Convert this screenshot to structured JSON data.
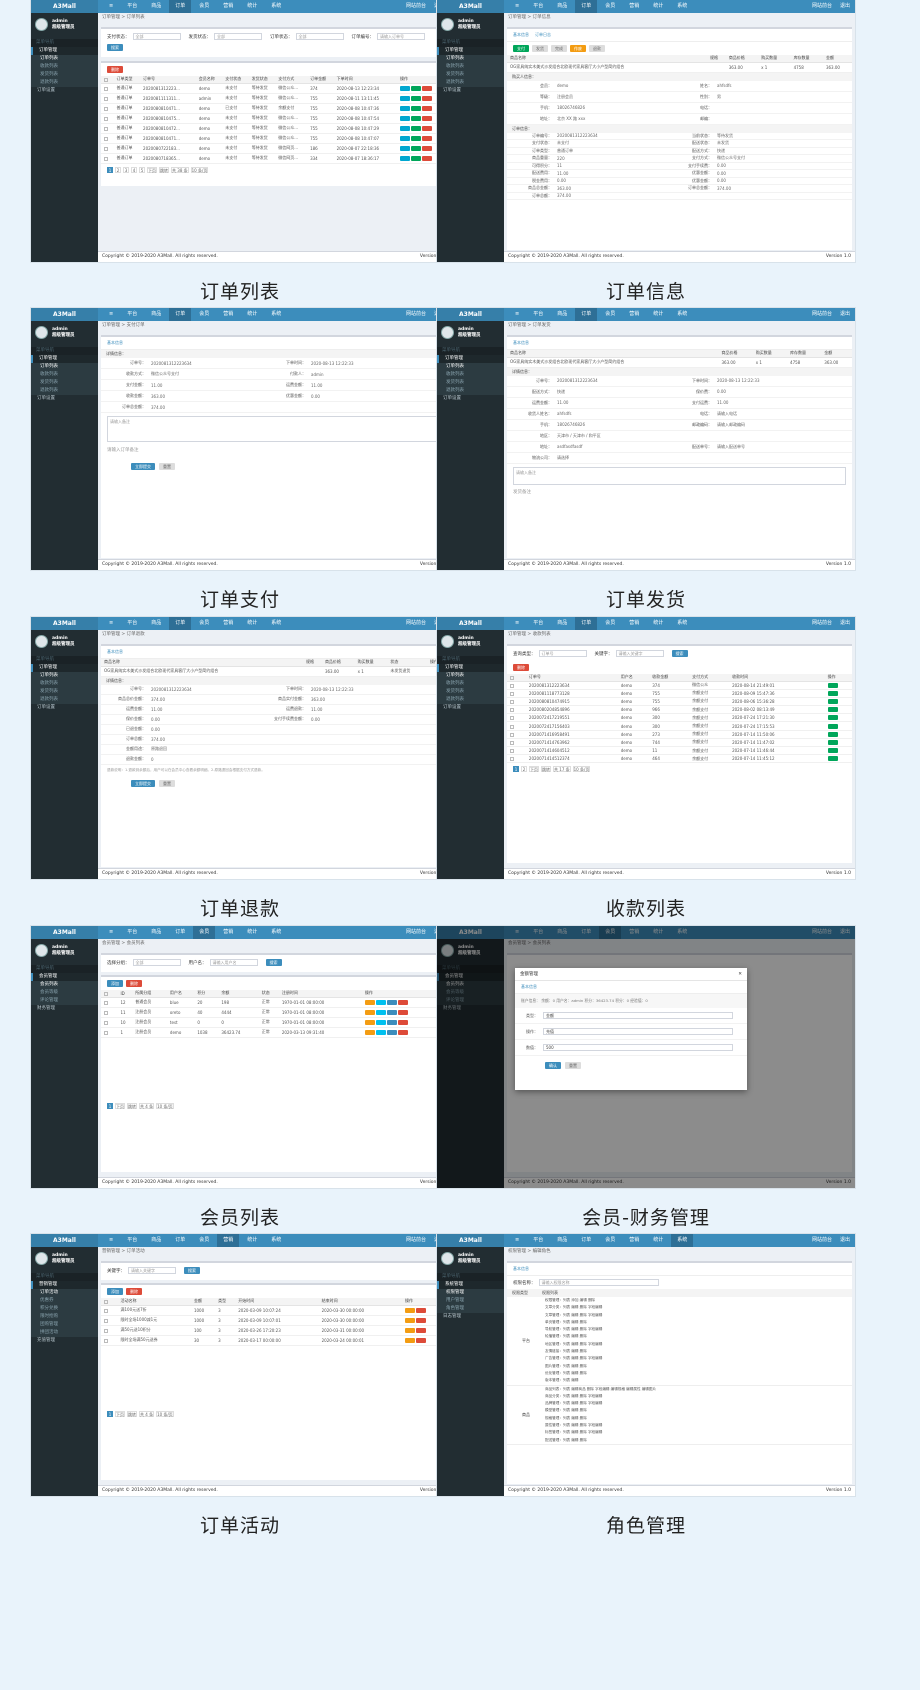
{
  "chrome": {
    "brand": "A3Mall",
    "top_nav": [
      "≡",
      "平台",
      "商品",
      "订单",
      "会员",
      "营销",
      "统计",
      "系统"
    ],
    "top_right": [
      "网站前台",
      "退出"
    ],
    "user_name": "admin",
    "user_role": "超级管理员",
    "search_label": "菜单导航",
    "footer_left": "Copyright © 2019-2020 A3Mall. All rights reserved.",
    "footer_right": "Version 1.0"
  },
  "screens": [
    {
      "caption": "订单列表",
      "crumb": "订单管理 > 订单列表",
      "menu": [
        "订单管理",
        "订单列表",
        "收款列表",
        "发货列表",
        "退款列表",
        "订单设置"
      ],
      "filters": [
        "支付状态：",
        "发货状态：",
        "订单状态：",
        "订单编号："
      ],
      "filter_values": [
        "全部",
        "全部",
        "全部",
        "请输入订单号"
      ],
      "search_btn": "搜索",
      "delete_btn": "删除",
      "columns": [
        "订单类型",
        "订单号",
        "会员名称",
        "支付状态",
        "发货状态",
        "支付方式",
        "订单金额",
        "下单时间",
        "操作"
      ],
      "rows": [
        [
          "普通订单",
          "2020081312223...",
          "demo",
          "未支付",
          "等待发货",
          "微信公众...",
          "374",
          "2020-08-13 12:23:34"
        ],
        [
          "普通订单",
          "2020081111311...",
          "admin",
          "未支付",
          "等待发货",
          "微信公众...",
          "755",
          "2020-08-11 13:11:45"
        ],
        [
          "普通订单",
          "2020080810471...",
          "demo",
          "已支付",
          "等待发货",
          "余额支付",
          "755",
          "2020-08-08 10:47:36"
        ],
        [
          "普通订单",
          "2020080810475...",
          "demo",
          "未支付",
          "等待发货",
          "微信公众...",
          "755",
          "2020-08-08 10:47:54"
        ],
        [
          "普通订单",
          "2020080810472...",
          "demo",
          "未支付",
          "等待发货",
          "微信公众...",
          "755",
          "2020-08-08 10:47:29"
        ],
        [
          "普通订单",
          "2020080810471...",
          "demo",
          "未支付",
          "等待发货",
          "微信公众...",
          "755",
          "2020-08-08 10:47:07"
        ],
        [
          "普通订单",
          "2020080722183...",
          "demo",
          "未支付",
          "等待发货",
          "微信网页...",
          "186",
          "2020-08-07 22:18:36"
        ],
        [
          "普通订单",
          "2020080718365...",
          "demo",
          "未支付",
          "等待发货",
          "微信网页...",
          "334",
          "2020-08-07 18:36:17"
        ]
      ],
      "pager": [
        "1",
        "2",
        "3",
        "4",
        "5",
        "下页",
        "跳转",
        "共 38 条",
        "10 条/页"
      ]
    },
    {
      "caption": "订单信息",
      "crumb": "订单管理 > 订单信息",
      "menu": [
        "订单管理",
        "订单列表",
        "收款列表",
        "发货列表",
        "退款列表",
        "订单设置"
      ],
      "tabs": [
        "基本信息",
        "订单日志"
      ],
      "action_btns": [
        "支付",
        "发货",
        "完成",
        "作废",
        "退款"
      ],
      "goods_columns": [
        "商品名称",
        "规格",
        "商品价格",
        "购买数量",
        "库存数量",
        "金额"
      ],
      "goods_row": [
        "OG家具纯实木美式沙发组合北欧现代家具客厅大小户型简约组合",
        "",
        "363.00",
        "x 1",
        "4758",
        "363.00"
      ],
      "buyer_title": "购买人信息：",
      "buyer": [
        [
          "会员：",
          "demo",
          "姓名：",
          "ahfsdfs"
        ],
        [
          "等级：",
          "注册会员",
          "性别：",
          "男"
        ],
        [
          "手机：",
          "18026746826",
          "电话：",
          ""
        ],
        [
          "地址：",
          "北京 XX 路 xxx",
          "邮编：",
          ""
        ]
      ],
      "order_title": "订单信息：",
      "order": [
        [
          "订单编号：",
          "2020081312223634",
          "当前状态：",
          "等待发货"
        ],
        [
          "支付状态：",
          "未支付",
          "配送状态：",
          "未发货"
        ],
        [
          "订单类型：",
          "普通订单",
          "配送方式：",
          "快递"
        ],
        [
          "商品重量：",
          "220",
          "支付方式：",
          "微信公众号支付"
        ],
        [
          "可得积分：",
          "11",
          "支付手续费：",
          "0.00"
        ],
        [
          "配送费用：",
          "11.00",
          "优惠金额：",
          "0.00"
        ],
        [
          "税金费用：",
          "0.00",
          "优惠金额：",
          "0.00"
        ],
        [
          "商品总金额：",
          "363.00",
          "订单总金额：",
          "374.00"
        ],
        [
          "订单总额：",
          "374.00",
          "",
          ""
        ]
      ]
    },
    {
      "caption": "订单支付",
      "crumb": "订单管理 > 支付订单",
      "menu": [
        "订单管理",
        "订单列表",
        "收款列表",
        "发货列表",
        "退款列表",
        "订单设置"
      ],
      "tab": "基本信息",
      "section": "详情信息：",
      "rows": [
        [
          "订单号：",
          "2020081312223634",
          "下单时间：",
          "2020-08-13 12:22:33"
        ],
        [
          "收款方式：",
          "微信公众号支付",
          "付款人：",
          "admin"
        ],
        [
          "支付金额：",
          "11.00",
          "运费金额：",
          "11.00"
        ],
        [
          "收款金额：",
          "363.00",
          "优惠金额：",
          "0.00"
        ],
        [
          "订单总金额：",
          "374.00",
          "",
          ""
        ]
      ],
      "note_placeholder": "请输入备注",
      "note_hint": "请输入订单备注",
      "submit": "立即提交",
      "reset": "重置"
    },
    {
      "caption": "订单发货",
      "crumb": "订单管理 > 订单发货",
      "menu": [
        "订单管理",
        "订单列表",
        "收款列表",
        "发货列表",
        "退款列表",
        "订单设置"
      ],
      "tab": "基本信息",
      "goods_columns": [
        "商品名称",
        "商品价格",
        "购买数量",
        "库存数量",
        "金额"
      ],
      "goods_row": [
        "OG家具纯实木美式沙发组合北欧现代家具客厅大小户型简约组合",
        "363.00",
        "x 1",
        "4758",
        "363.00"
      ],
      "section": "详情信息：",
      "rows": [
        [
          "订单号：",
          "2020081312223634",
          "下单时间：",
          "2020-08-13 12:22:33"
        ],
        [
          "配送方式：",
          "快递",
          "保价费：",
          "0.00"
        ],
        [
          "运费金额：",
          "11.00",
          "支付运费：",
          "11.00"
        ],
        [
          "收货人姓名：",
          "ahfsdfs",
          "电话：",
          "请输入电话"
        ],
        [
          "手机：",
          "18026746826",
          "邮政编码：",
          "请输入邮政编码"
        ],
        [
          "地区：",
          "天津市 / 天津市 / 和平区",
          "",
          ""
        ],
        [
          "地址：",
          "asdfasdfasdf",
          "配送单号：",
          "请输入配送单号"
        ],
        [
          "物流公司：",
          "请选择",
          "",
          ""
        ]
      ],
      "note_placeholder": "请输入备注",
      "note_hint": "发货备注"
    },
    {
      "caption": "订单退款",
      "crumb": "订单管理 > 订单退款",
      "menu": [
        "订单管理",
        "订单列表",
        "收款列表",
        "发货列表",
        "退款列表",
        "订单设置"
      ],
      "tab": "基本信息",
      "goods_columns": [
        "商品名称",
        "规格",
        "商品价格",
        "购买数量",
        "状态",
        "操作"
      ],
      "goods_row": [
        "OG家具纯实木美式沙发组合北欧现代家具客厅大小户型简约组合",
        "",
        "363.00",
        "x 1",
        "未发货退货",
        ""
      ],
      "section": "详情信息：",
      "rows": [
        [
          "订单号：",
          "2020081312223634",
          "下单时间：",
          "2020-08-13 12:22:33"
        ],
        [
          "商品总价金额：",
          "374.00",
          "商品实付金额：",
          "363.00"
        ],
        [
          "运费金额：",
          "11.00",
          "运费退款：",
          "11.00"
        ],
        [
          "保价金额：",
          "0.00",
          "支付手续费金额：",
          "0.00"
        ],
        [
          "已退金额：",
          "0.00",
          "",
          ""
        ],
        [
          "订单总额：",
          "374.00",
          "",
          ""
        ],
        [
          "金额用途：",
          "原路退回",
          "",
          ""
        ],
        [
          "退款金额：",
          "0",
          "",
          ""
        ]
      ],
      "hint": "退款说明：1.退款到余额后，用户可以在会员中心查看余额明细。2.原路退回会根据支付方式退款。",
      "submit": "立即提交",
      "reset": "重置"
    },
    {
      "caption": "收款列表",
      "crumb": "订单管理 > 收款列表",
      "menu": [
        "订单管理",
        "订单列表",
        "收款列表",
        "发货列表",
        "退款列表",
        "订单设置"
      ],
      "filters": [
        "查询类型：",
        "关键字："
      ],
      "filter_values": [
        "订单号",
        "请输入关键字"
      ],
      "search_btn": "搜索",
      "delete_btn": "删除",
      "columns": [
        "订单号",
        "用户名",
        "收款金额",
        "支付方式",
        "收款时间",
        "操作"
      ],
      "rows": [
        [
          "2020081312223634",
          "demo",
          "374",
          "微信公众",
          "2020-08-14 21:49:01"
        ],
        [
          "2020081118773128",
          "demo",
          "755",
          "余额支付",
          "2020-08-09 15:47:36"
        ],
        [
          "2020080810474915",
          "demo",
          "755",
          "余额支付",
          "2020-08-06 15:36:28"
        ],
        [
          "2020080204854896",
          "demo",
          "966",
          "余额支付",
          "2020-08-02 08:13:49"
        ],
        [
          "2020072417219551",
          "demo",
          "300",
          "余额支付",
          "2020-07-24 17:21:30"
        ],
        [
          "2020072417156403",
          "demo",
          "300",
          "余额支付",
          "2020-07-24 17:15:53"
        ],
        [
          "2020071416958491",
          "demo",
          "273",
          "余额支付",
          "2020-07-14 11:50:06"
        ],
        [
          "2020071414763962",
          "demo",
          "744",
          "余额支付",
          "2020-07-14 11:47:02"
        ],
        [
          "2020071414604512",
          "demo",
          "11",
          "余额支付",
          "2020-07-14 11:46:44"
        ],
        [
          "2020071414512374",
          "demo",
          "464",
          "余额支付",
          "2020-07-14 11:45:12"
        ]
      ],
      "pager": [
        "1",
        "2",
        "下页",
        "跳转",
        "共 17 条",
        "10 条/页"
      ]
    },
    {
      "caption": "会员列表",
      "crumb": "会员管理 > 会员列表",
      "menu": [
        "会员管理",
        "会员列表",
        "会员等级",
        "评论管理",
        "财务管理"
      ],
      "filters": [
        "选择分组：",
        "用户名："
      ],
      "filter_values": [
        "全部",
        "请输入用户名"
      ],
      "search_btn": "搜索",
      "add_btn": "添加",
      "delete_btn": "删除",
      "columns": [
        "ID",
        "所属分组",
        "用户名",
        "积分",
        "余额",
        "状态",
        "注册时间",
        "操作"
      ],
      "rows": [
        [
          "12",
          "普通会员",
          "blue",
          "20",
          "198",
          "正常",
          "1970-01-01 08:00:00"
        ],
        [
          "11",
          "注册会员",
          "oreto",
          "40",
          "4444",
          "正常",
          "1970-01-01 08:00:00"
        ],
        [
          "10",
          "注册会员",
          "test",
          "0",
          "0",
          "正常",
          "1970-01-01 08:00:00"
        ],
        [
          "1",
          "注册会员",
          "demo",
          "1038",
          "36423.74",
          "正常",
          "2020-03-13 09:31:40"
        ]
      ],
      "pager": [
        "1",
        "下页",
        "跳转",
        "共 4 条",
        "10 条/页"
      ]
    },
    {
      "caption": "会员-财务管理",
      "crumb": "会员管理 > 会员列表",
      "menu": [
        "会员管理",
        "会员列表",
        "会员等级",
        "评论管理",
        "财务管理"
      ],
      "modal_title": "金额管理",
      "modal_tab": "基本信息",
      "account_line": "账户信息：  余额：0  用户名：admin  积分：36423.74  积分：0  经验值：0",
      "fields": [
        [
          "类型：",
          "金额"
        ],
        [
          "操作：",
          "充值"
        ],
        [
          "数值：",
          "500"
        ]
      ],
      "confirm": "确认",
      "reset": "重置"
    },
    {
      "caption": "订单活动",
      "crumb": "营销管理 > 订单活动",
      "menu": [
        "营销管理",
        "订单活动",
        "优惠券",
        "积分兑换",
        "限时抢购",
        "团购管理",
        "拼团活动",
        "充值管理"
      ],
      "filters": [
        "关键字："
      ],
      "filter_values": [
        "请输入关键字"
      ],
      "search_btn": "搜索",
      "add_btn": "添加",
      "delete_btn": "删除",
      "columns": [
        "活动名称",
        "金额",
        "类型",
        "开始时间",
        "结束时间",
        "操作"
      ],
      "rows": [
        [
          "满100元送7折",
          "1000",
          "3",
          "2020-03-09 10:07:24",
          "2020-03-30 00:00:00"
        ],
        [
          "限时全场1000减1元",
          "1000",
          "3",
          "2020-03-09 10:07:01",
          "2020-03-30 00:00:00"
        ],
        [
          "满50元送10积分",
          "100",
          "3",
          "2020-03-26 17:20:23",
          "2020-03-31 00:00:00"
        ],
        [
          "限时全场满50元送券",
          "30",
          "3",
          "2020-03-17 00:00:00",
          "2020-03-24 00:00:01"
        ]
      ],
      "pager": [
        "1",
        "下页",
        "跳转",
        "共 4 条",
        "10 条/页"
      ]
    },
    {
      "caption": "角色管理",
      "crumb": "权限管理 > 编辑角色",
      "menu": [
        "系统管理",
        "权限管理",
        "用户管理",
        "角色管理",
        "日志管理"
      ],
      "tab": "基本信息",
      "role_label": "权限名称：",
      "role_placeholder": "请输入权限名称",
      "columns": [
        "权限类型",
        "权限列表"
      ],
      "groups": [
        {
          "name": "平台",
          "lines": [
            "权限管理：列表 添加 编辑 删除",
            "文章分类：列表 编辑 删除 字段编辑",
            "文章管理：列表 编辑 删除 字段编辑",
            "单页管理：列表 编辑 删除",
            "导航管理：列表 编辑 删除 字段编辑",
            "轮播管理：列表 编辑 删除",
            "地区管理：列表 编辑 删除 字段编辑",
            "友情链接：列表 编辑 删除",
            "广告管理：列表 编辑 删除 字段编辑",
            "图片管理：列表 编辑 删除",
            "优化管理：列表 编辑 删除",
            "版本管理：列表 编辑"
          ]
        },
        {
          "name": "商品",
          "lines": [
            "商品列表：列表 编辑商品 删除 字段编辑 编辑规格 编辑属性 编辑图片",
            "商品分类：列表 编辑 删除 字段编辑",
            "品牌管理：列表 编辑 删除 字段编辑",
            "模型管理：列表 编辑 删除",
            "规格管理：列表 编辑 删除",
            "属性管理：列表 编辑 删除 字段编辑",
            "标签管理：列表 编辑 删除 字段编辑",
            "配送管理：列表 编辑 删除"
          ]
        }
      ]
    }
  ]
}
